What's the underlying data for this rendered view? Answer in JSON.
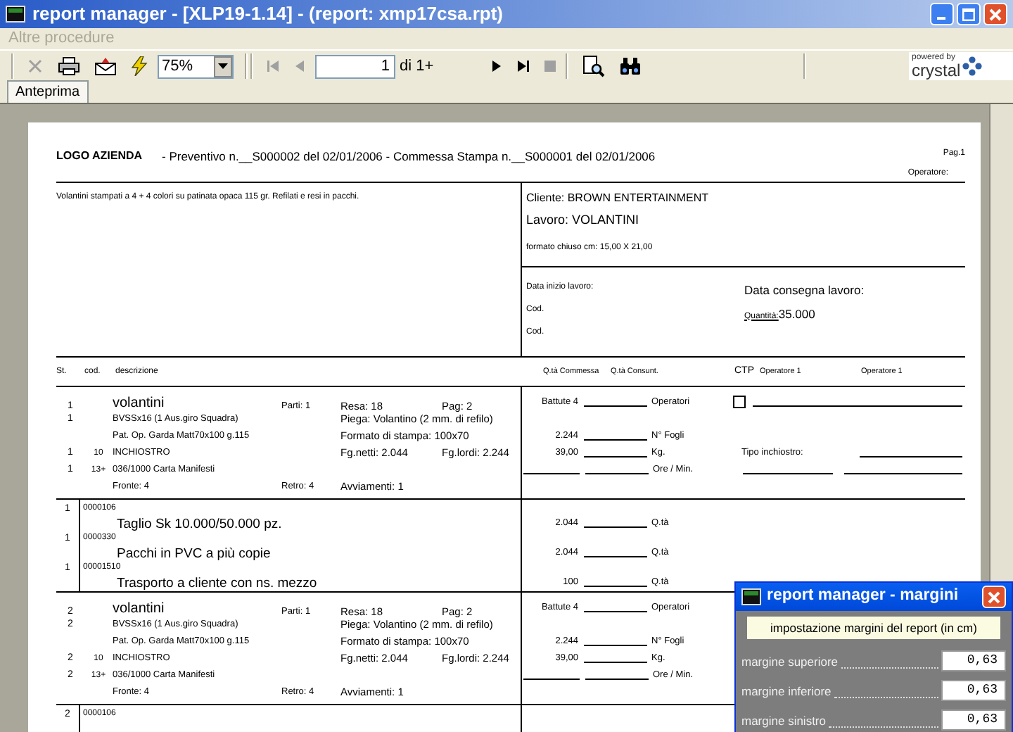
{
  "window": {
    "title": "report manager - [XLP19-1.14] - (report: xmp17csa.rpt)"
  },
  "menu": [
    {
      "label": "Altre procedure",
      "disabled": true
    }
  ],
  "toolbar": {
    "actions": [
      {
        "kind": "close",
        "disabled": true
      },
      {
        "kind": "print",
        "disabled": false
      },
      {
        "kind": "export",
        "disabled": false
      },
      {
        "kind": "refresh",
        "disabled": false
      }
    ],
    "zoom": "75%",
    "nav_back": [
      {
        "kind": "first",
        "disabled": true
      },
      {
        "kind": "prev",
        "disabled": true
      }
    ],
    "page": "1",
    "page_of": "di 1+",
    "nav_forward": [
      {
        "kind": "next",
        "disabled": false
      },
      {
        "kind": "last",
        "disabled": false
      },
      {
        "kind": "stop",
        "disabled": true
      }
    ],
    "tools": [
      {
        "kind": "search_page",
        "disabled": false
      },
      {
        "kind": "find",
        "disabled": false
      }
    ],
    "logo": {
      "tagline": "powered by",
      "name": "crystal"
    }
  },
  "tabs": [
    {
      "label": "Anteprima",
      "selected": true
    }
  ],
  "report": {
    "header": {
      "logo": "LOGO AZIENDA",
      "title": "- Preventivo n.__S000002 del 02/01/2006 - Commessa Stampa n.__S000001 del 02/01/2006",
      "page": "Pag.1",
      "operator": "Operatore:"
    },
    "summary": {
      "description": "Volantini stampati a 4 + 4 colori su patinata opaca 115 gr. Refilati e resi in pacchi.",
      "client": "Cliente: BROWN ENTERTAINMENT",
      "job": "Lavoro: VOLANTINI",
      "format": "formato chiuso cm: 15,00 X 21,00",
      "start_date": "Data inizio lavoro:",
      "codes": [
        "Cod.",
        "Cod."
      ],
      "delivery": "Data consegna lavoro:",
      "quantity_label": "Quantità:",
      "quantity": "35.000"
    },
    "columns": [
      "St.",
      "cod.",
      "descrizione",
      "Q.tà Commessa",
      "Q.tà Consunt.",
      "CTP",
      "Operatore 1",
      "Operatore 1"
    ],
    "sections": [
      {
        "kind": "job",
        "lines": [
          {
            "kind": "title",
            "st": "1",
            "description": "volantini",
            "detail_1": "Parti: 1",
            "detail_2": "Resa: 18",
            "detail_3": "Pag: 2",
            "right": {
              "qty": "Battute 4",
              "unit": "Operatori",
              "extra": {
                "kind": "ctp",
                "checked": false
              }
            }
          },
          {
            "kind": "detail",
            "st": "1",
            "description": "BVSSx16 (1 Aus.giro Squadra)",
            "detail_2": "Piega: Volantino (2 mm. di refilo)"
          },
          {
            "kind": "detail",
            "description": "Pat. Op. Garda Matt70x100 g.115",
            "detail_2": "Formato di stampa: 100x70",
            "right": {
              "qty": "2.244",
              "unit": "N° Fogli"
            }
          },
          {
            "kind": "detail",
            "st": "1",
            "cod": "10",
            "description": "INCHIOSTRO",
            "detail_2": "Fg.netti: 2.044",
            "detail_3": "Fg.lordi: 2.244",
            "right": {
              "qty": "39,00",
              "unit": "Kg.",
              "extra": {
                "kind": "ink",
                "label": "Tipo inchiostro:"
              }
            }
          },
          {
            "kind": "detail",
            "st": "1",
            "cod": "13+",
            "description": "036/1000 Carta Manifesti",
            "right": {
              "unit": "Ore / Min.",
              "extra": {
                "kind": "operators"
              }
            }
          },
          {
            "kind": "detail",
            "description": "Fronte: 4",
            "detail_1": "Retro: 4",
            "detail_2": "Avviamenti: 1"
          }
        ]
      },
      {
        "kind": "ops",
        "items": [
          {
            "st": "1",
            "cod": "0000106",
            "description": "Taglio Sk 10.000/50.000 pz.",
            "qty": "2.044",
            "unit": "Q.tà"
          },
          {
            "st": "1",
            "cod": "0000330",
            "description": "Pacchi in PVC a più copie",
            "qty": "2.044",
            "unit": "Q.tà"
          },
          {
            "st": "1",
            "cod": "00001510",
            "description": "Trasporto a cliente con ns. mezzo",
            "qty": "100",
            "unit": "Q.tà"
          }
        ]
      },
      {
        "kind": "job",
        "lines": [
          {
            "kind": "title",
            "st": "2",
            "description": "volantini",
            "detail_1": "Parti: 1",
            "detail_2": "Resa: 18",
            "detail_3": "Pag: 2",
            "right": {
              "qty": "Battute 4",
              "unit": "Operatori"
            }
          },
          {
            "kind": "detail",
            "st": "2",
            "description": "BVSSx16 (1 Aus.giro Squadra)",
            "detail_2": "Piega: Volantino (2 mm. di refilo)"
          },
          {
            "kind": "detail",
            "description": "Pat. Op. Garda Matt70x100 g.115",
            "detail_2": "Formato di stampa: 100x70",
            "right": {
              "qty": "2.244",
              "unit": "N° Fogli"
            }
          },
          {
            "kind": "detail",
            "st": "2",
            "cod": "10",
            "description": "INCHIOSTRO",
            "detail_2": "Fg.netti: 2.044",
            "detail_3": "Fg.lordi: 2.244",
            "right": {
              "qty": "39,00",
              "unit": "Kg."
            }
          },
          {
            "kind": "detail",
            "st": "2",
            "cod": "13+",
            "description": "036/1000 Carta Manifesti",
            "right": {
              "unit": "Ore / Min."
            }
          },
          {
            "kind": "detail",
            "description": "Fronte: 4",
            "detail_1": "Retro: 4",
            "detail_2": "Avviamenti: 1"
          }
        ]
      },
      {
        "kind": "ops",
        "items": [
          {
            "st": "2",
            "cod": "0000106"
          }
        ]
      }
    ]
  },
  "dialog": {
    "title": "report manager - margini",
    "caption": "impostazione margini del report (in cm)",
    "fields": [
      {
        "label": "margine superiore",
        "value": "0,63"
      },
      {
        "label": "margine inferiore",
        "value": "0,63"
      },
      {
        "label": "margine sinistro",
        "value": "0,63"
      }
    ]
  }
}
